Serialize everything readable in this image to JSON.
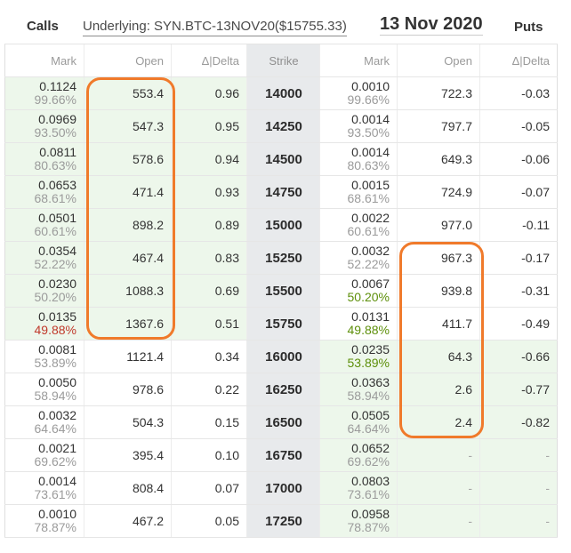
{
  "header": {
    "calls_label": "Calls",
    "underlying": "Underlying: SYN.BTC-13NOV20($15755.33)",
    "expiry": "13 Nov 2020",
    "puts_label": "Puts"
  },
  "columns": {
    "call_mark": "Mark",
    "call_open": "Open",
    "call_delta": "Δ|Delta",
    "strike": "Strike",
    "put_mark": "Mark",
    "put_open": "Open",
    "put_delta": "Δ|Delta"
  },
  "colors": {
    "itm_background": "#edf7eb",
    "strike_background": "#e8eaec",
    "highlight_border": "#f07a2b",
    "iv_default": "#9b9b9b"
  },
  "rows": [
    {
      "strike": "14000",
      "call": {
        "mark": "0.1124",
        "iv": "99.66%",
        "open": "553.4",
        "delta": "0.96",
        "itm": true,
        "open_boxed": true
      },
      "put": {
        "mark": "0.0010",
        "iv": "99.66%",
        "open": "722.3",
        "delta": "-0.03",
        "itm": false,
        "open_boxed": false
      }
    },
    {
      "strike": "14250",
      "call": {
        "mark": "0.0969",
        "iv": "93.50%",
        "open": "547.3",
        "delta": "0.95",
        "itm": true,
        "open_boxed": true
      },
      "put": {
        "mark": "0.0014",
        "iv": "93.50%",
        "open": "797.7",
        "delta": "-0.05",
        "itm": false,
        "open_boxed": false
      }
    },
    {
      "strike": "14500",
      "call": {
        "mark": "0.0811",
        "iv": "80.63%",
        "open": "578.6",
        "delta": "0.94",
        "itm": true,
        "open_boxed": true
      },
      "put": {
        "mark": "0.0014",
        "iv": "80.63%",
        "open": "649.3",
        "delta": "-0.06",
        "itm": false,
        "open_boxed": false
      }
    },
    {
      "strike": "14750",
      "call": {
        "mark": "0.0653",
        "iv": "68.61%",
        "open": "471.4",
        "delta": "0.93",
        "itm": true,
        "open_boxed": true
      },
      "put": {
        "mark": "0.0015",
        "iv": "68.61%",
        "open": "724.9",
        "delta": "-0.07",
        "itm": false,
        "open_boxed": false
      }
    },
    {
      "strike": "15000",
      "call": {
        "mark": "0.0501",
        "iv": "60.61%",
        "open": "898.2",
        "delta": "0.89",
        "itm": true,
        "open_boxed": true
      },
      "put": {
        "mark": "0.0022",
        "iv": "60.61%",
        "open": "977.0",
        "delta": "-0.11",
        "itm": false,
        "open_boxed": false
      }
    },
    {
      "strike": "15250",
      "call": {
        "mark": "0.0354",
        "iv": "52.22%",
        "open": "467.4",
        "delta": "0.83",
        "itm": true,
        "open_boxed": true
      },
      "put": {
        "mark": "0.0032",
        "iv": "52.22%",
        "open": "967.3",
        "delta": "-0.17",
        "itm": false,
        "open_boxed": true
      }
    },
    {
      "strike": "15500",
      "call": {
        "mark": "0.0230",
        "iv": "50.20%",
        "open": "1088.3",
        "delta": "0.69",
        "itm": true,
        "open_boxed": true
      },
      "put": {
        "mark": "0.0067",
        "iv": "50.20%",
        "iv_color": "#5d8f0a",
        "open": "939.8",
        "delta": "-0.31",
        "itm": false,
        "open_boxed": true
      }
    },
    {
      "strike": "15750",
      "call": {
        "mark": "0.0135",
        "iv": "49.88%",
        "iv_color": "#c0392b",
        "open": "1367.6",
        "delta": "0.51",
        "itm": true,
        "open_boxed": true
      },
      "put": {
        "mark": "0.0131",
        "iv": "49.88%",
        "iv_color": "#5d8f0a",
        "open": "411.7",
        "delta": "-0.49",
        "itm": false,
        "open_boxed": true
      }
    },
    {
      "strike": "16000",
      "call": {
        "mark": "0.0081",
        "iv": "53.89%",
        "open": "1121.4",
        "delta": "0.34",
        "itm": false,
        "open_boxed": false
      },
      "put": {
        "mark": "0.0235",
        "iv": "53.89%",
        "iv_color": "#5d8f0a",
        "open": "64.3",
        "delta": "-0.66",
        "itm": true,
        "open_boxed": true
      }
    },
    {
      "strike": "16250",
      "call": {
        "mark": "0.0050",
        "iv": "58.94%",
        "open": "978.6",
        "delta": "0.22",
        "itm": false,
        "open_boxed": false
      },
      "put": {
        "mark": "0.0363",
        "iv": "58.94%",
        "open": "2.6",
        "delta": "-0.77",
        "itm": true,
        "open_boxed": true
      }
    },
    {
      "strike": "16500",
      "call": {
        "mark": "0.0032",
        "iv": "64.64%",
        "open": "504.3",
        "delta": "0.15",
        "itm": false,
        "open_boxed": false
      },
      "put": {
        "mark": "0.0505",
        "iv": "64.64%",
        "open": "2.4",
        "delta": "-0.82",
        "itm": true,
        "open_boxed": true
      }
    },
    {
      "strike": "16750",
      "call": {
        "mark": "0.0021",
        "iv": "69.62%",
        "open": "395.4",
        "delta": "0.10",
        "itm": false,
        "open_boxed": false
      },
      "put": {
        "mark": "0.0652",
        "iv": "69.62%",
        "open": "-",
        "delta": "-",
        "itm": true,
        "open_boxed": false
      }
    },
    {
      "strike": "17000",
      "call": {
        "mark": "0.0014",
        "iv": "73.61%",
        "open": "808.4",
        "delta": "0.07",
        "itm": false,
        "open_boxed": false
      },
      "put": {
        "mark": "0.0803",
        "iv": "73.61%",
        "open": "-",
        "delta": "-",
        "itm": true,
        "open_boxed": false
      }
    },
    {
      "strike": "17250",
      "call": {
        "mark": "0.0010",
        "iv": "78.87%",
        "open": "467.2",
        "delta": "0.05",
        "itm": false,
        "open_boxed": false
      },
      "put": {
        "mark": "0.0958",
        "iv": "78.87%",
        "open": "-",
        "delta": "-",
        "itm": true,
        "open_boxed": false
      }
    }
  ]
}
